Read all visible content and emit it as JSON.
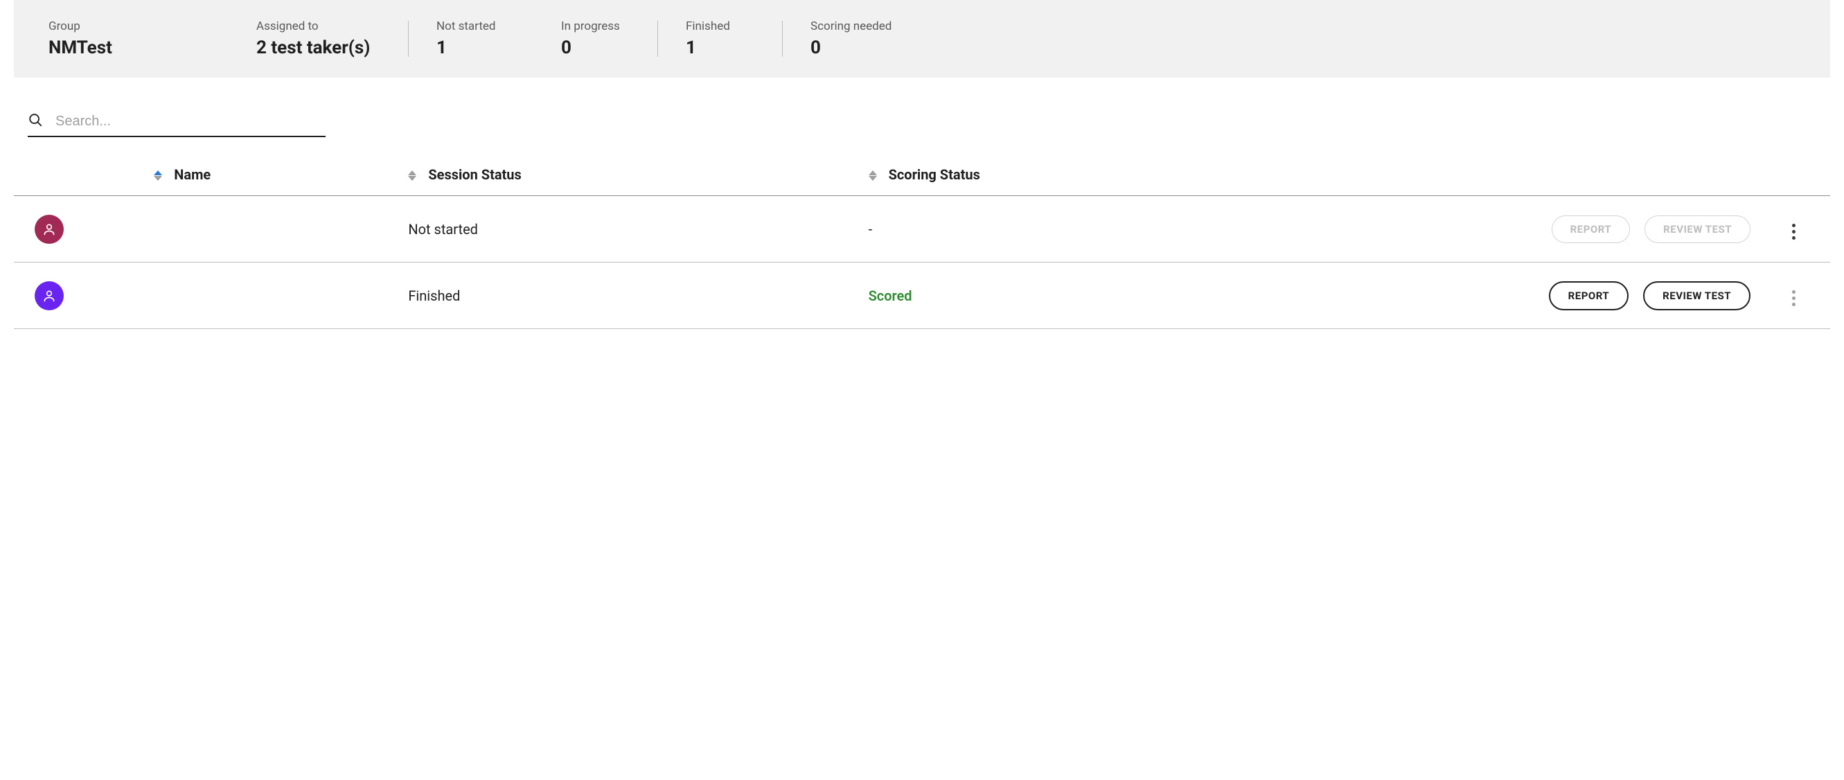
{
  "summary": {
    "group": {
      "label": "Group",
      "value": "NMTest"
    },
    "assigned": {
      "label": "Assigned to",
      "value": "2 test taker(s)"
    },
    "not_started": {
      "label": "Not started",
      "value": "1"
    },
    "in_progress": {
      "label": "In progress",
      "value": "0"
    },
    "finished": {
      "label": "Finished",
      "value": "1"
    },
    "scoring_needed": {
      "label": "Scoring needed",
      "value": "0"
    }
  },
  "search": {
    "placeholder": "Search..."
  },
  "table": {
    "headers": {
      "name": "Name",
      "session_status": "Session Status",
      "scoring_status": "Scoring Status"
    },
    "actions": {
      "report": "REPORT",
      "review": "REVIEW TEST"
    },
    "rows": [
      {
        "avatar_color": "avatar-maroon",
        "name": "",
        "session_status": "Not started",
        "scoring_status": "-",
        "scoring_is_scored": false,
        "actions_enabled": false,
        "menu_dim": false
      },
      {
        "avatar_color": "avatar-purple",
        "name": "",
        "session_status": "Finished",
        "scoring_status": "Scored",
        "scoring_is_scored": true,
        "actions_enabled": true,
        "menu_dim": true
      }
    ]
  }
}
